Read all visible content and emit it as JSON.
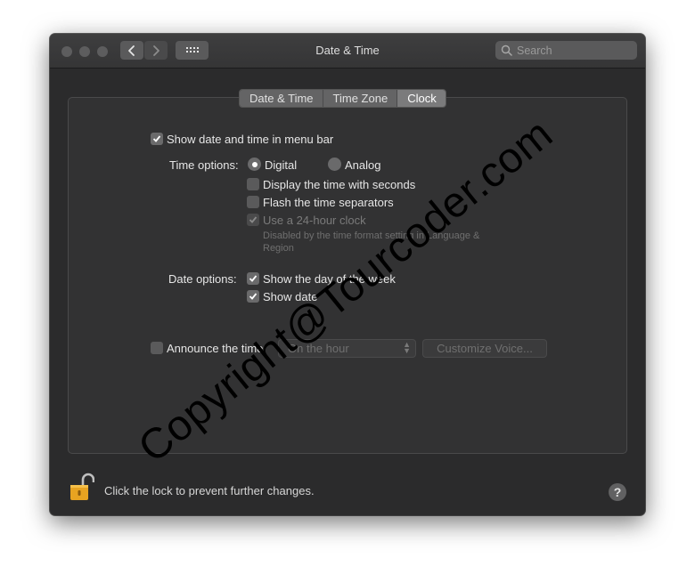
{
  "window": {
    "title": "Date & Time",
    "search_placeholder": "Search"
  },
  "tabs": [
    {
      "label": "Date & Time",
      "active": false
    },
    {
      "label": "Time Zone",
      "active": false
    },
    {
      "label": "Clock",
      "active": true
    }
  ],
  "clock": {
    "show_in_menu_bar": {
      "label": "Show date and time in menu bar",
      "checked": true
    },
    "time_options_label": "Time options:",
    "digital": {
      "label": "Digital",
      "selected": true
    },
    "analog": {
      "label": "Analog",
      "selected": false
    },
    "display_seconds": {
      "label": "Display the time with seconds",
      "checked": false
    },
    "flash_separators": {
      "label": "Flash the time separators",
      "checked": false
    },
    "use_24_hour": {
      "label": "Use a 24-hour clock",
      "checked": true,
      "disabled": true
    },
    "disabled_note": "Disabled by the time format setting in Language & Region",
    "date_options_label": "Date options:",
    "show_day_of_week": {
      "label": "Show the day of the week",
      "checked": true
    },
    "show_date": {
      "label": "Show date",
      "checked": true
    },
    "announce_time": {
      "label": "Announce the time:",
      "checked": false
    },
    "announce_interval": "On the hour",
    "customize_voice_label": "Customize Voice..."
  },
  "footer": {
    "lock_text": "Click the lock to prevent further changes.",
    "help_label": "?"
  },
  "watermark": "Copyright@Tourcoder.com",
  "colors": {
    "window_bg": "#2b2b2c",
    "panel_bg": "#323233",
    "lock_gold": "#e8a321"
  }
}
